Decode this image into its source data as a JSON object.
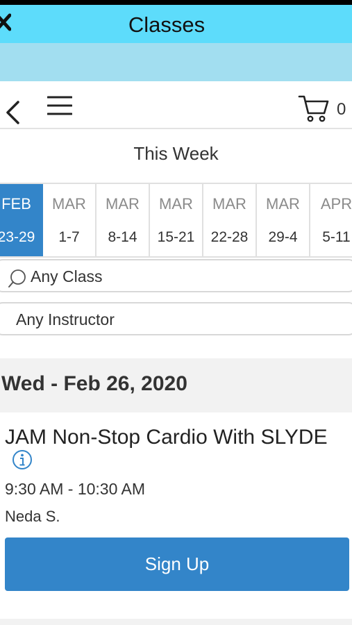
{
  "header": {
    "title": "Classes",
    "title_bar_color": "#5ddcfb",
    "sub_bar_color": "#a2def0"
  },
  "nav": {
    "back_icon": "chevron-left-icon",
    "menu_icon": "hamburger-menu-icon",
    "cart_icon": "cart-icon",
    "cart_count": "0"
  },
  "week_label": "This Week",
  "weeks": [
    {
      "month": "FEB",
      "range": "23-29",
      "selected": true
    },
    {
      "month": "MAR",
      "range": "1-7"
    },
    {
      "month": "MAR",
      "range": "8-14"
    },
    {
      "month": "MAR",
      "range": "15-21"
    },
    {
      "month": "MAR",
      "range": "22-28"
    },
    {
      "month": "MAR",
      "range": "29-4"
    },
    {
      "month": "APR",
      "range": "5-11"
    }
  ],
  "filters": {
    "class_value": "Any Class",
    "instructor_value": "Any Instructor"
  },
  "day_header": "Wed - Feb 26, 2020",
  "class_item": {
    "title": "JAM Non-Stop Cardio With SLYDE",
    "time": "9:30 AM - 10:30 AM",
    "instructor": "Neda S.",
    "button_label": "Sign Up"
  },
  "colors": {
    "accent": "#3385c9"
  }
}
